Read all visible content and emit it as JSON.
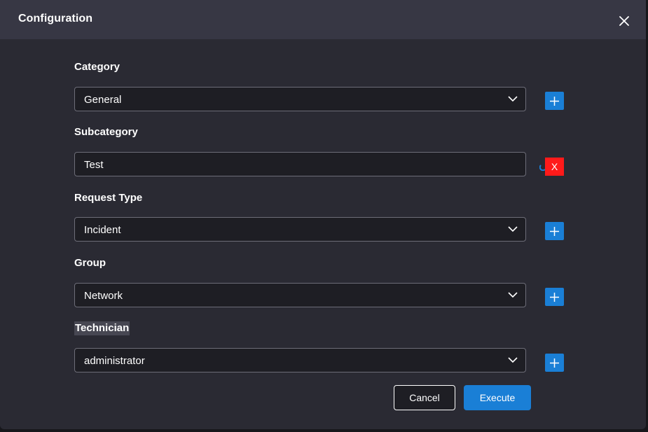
{
  "dialog": {
    "title": "Configuration",
    "close_icon": "close-icon"
  },
  "fields": {
    "category": {
      "label": "Category",
      "value": "General",
      "type": "select"
    },
    "subcategory": {
      "label": "Subcategory",
      "value": "Test",
      "type": "text"
    },
    "request_type": {
      "label": "Request Type",
      "value": "Incident",
      "type": "select"
    },
    "group": {
      "label": "Group",
      "value": "Network",
      "type": "select"
    },
    "technician": {
      "label": "Technician",
      "value": "administrator",
      "type": "select"
    }
  },
  "remove_button": {
    "label": "X",
    "color": "#ff1a1a"
  },
  "actions": {
    "cancel_label": "Cancel",
    "execute_label": "Execute"
  },
  "colors": {
    "accent": "#1a7fd6",
    "background": "#2a2a33",
    "header": "#373744",
    "input_bg": "#1e1e24"
  }
}
